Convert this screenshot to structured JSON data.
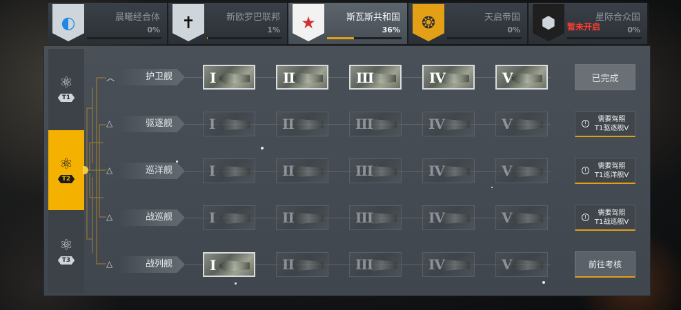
{
  "factions": [
    {
      "name": "晨曦经合体",
      "progress": "0%",
      "progress_value": 0,
      "emblem_color": "#1e88e5",
      "emblem_bg": "#cfd6db",
      "icon": "disc-icon",
      "active": false,
      "locked": ""
    },
    {
      "name": "新欧罗巴联邦",
      "progress": "1%",
      "progress_value": 1,
      "emblem_color": "#111111",
      "emblem_bg": "#cfd6db",
      "icon": "cross-icon",
      "active": false,
      "locked": ""
    },
    {
      "name": "斯瓦斯共和国",
      "progress": "36%",
      "progress_value": 36,
      "emblem_color": "#d32f2f",
      "emblem_bg": "#f2f2f2",
      "icon": "star-icon",
      "active": true,
      "locked": ""
    },
    {
      "name": "天启帝国",
      "progress": "0%",
      "progress_value": 0,
      "emblem_color": "#2b2b2b",
      "emblem_bg": "#e3a017",
      "icon": "rings-icon",
      "active": false,
      "locked": ""
    },
    {
      "name": "星际合众国",
      "progress": "0%",
      "progress_value": 0,
      "emblem_color": "#cfd6db",
      "emblem_bg": "#1f1f1f",
      "icon": "hex-icon",
      "active": false,
      "locked": "暂未开启"
    }
  ],
  "tiers": [
    {
      "label": "T1",
      "active": false
    },
    {
      "label": "T2",
      "active": true
    },
    {
      "label": "T3",
      "active": false
    }
  ],
  "numerals": [
    "I",
    "II",
    "III",
    "IV",
    "V"
  ],
  "rows": [
    {
      "label": "护卫舰",
      "caret": "︿",
      "unlocked_stages": [
        0,
        1,
        2,
        3,
        4
      ],
      "action": {
        "type": "done",
        "text": "已完成"
      }
    },
    {
      "label": "驱逐舰",
      "caret": "△",
      "unlocked_stages": [],
      "action": {
        "type": "req",
        "line1": "需要驾照",
        "line2": "T1驱逐舰V"
      }
    },
    {
      "label": "巡洋舰",
      "caret": "△",
      "unlocked_stages": [],
      "action": {
        "type": "req",
        "line1": "需要驾照",
        "line2": "T1巡洋舰V"
      }
    },
    {
      "label": "战巡舰",
      "caret": "△",
      "unlocked_stages": [],
      "action": {
        "type": "req",
        "line1": "需要驾照",
        "line2": "T1战巡舰V"
      }
    },
    {
      "label": "战列舰",
      "caret": "△",
      "unlocked_stages": [
        0
      ],
      "action": {
        "type": "go",
        "text": "前往考核"
      }
    }
  ],
  "accent": "#f5b100"
}
